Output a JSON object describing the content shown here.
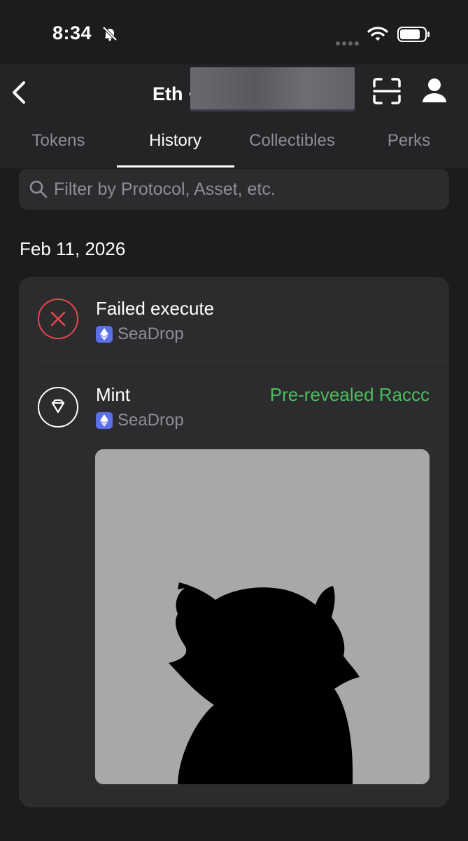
{
  "status": {
    "time": "8:34"
  },
  "header": {
    "title": "Eth ·",
    "tabs": [
      {
        "label": "Tokens"
      },
      {
        "label": "History"
      },
      {
        "label": "Collectibles"
      },
      {
        "label": "Perks"
      }
    ],
    "active_tab": "History"
  },
  "search": {
    "placeholder": "Filter by Protocol, Asset, etc."
  },
  "history": {
    "date": "Feb 11, 2026",
    "items": [
      {
        "title": "Failed execute",
        "protocol": "SeaDrop",
        "status_color": "#e5484d"
      },
      {
        "title": "Mint",
        "protocol": "SeaDrop",
        "value": "Pre-revealed Raccc",
        "value_color": "#4cbb5e"
      }
    ]
  },
  "icons": [
    "back-chevron-icon",
    "bell-slash-icon",
    "wifi-icon",
    "battery-icon",
    "scan-icon",
    "profile-icon",
    "search-icon",
    "failed-x-icon",
    "diamond-icon",
    "ethereum-icon"
  ]
}
